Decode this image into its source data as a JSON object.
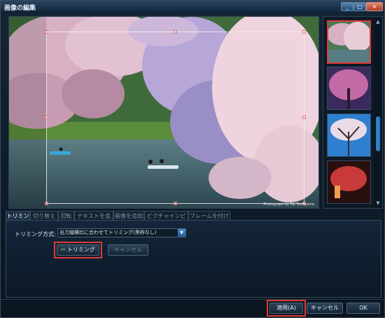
{
  "window": {
    "title": "画像の編集",
    "controls": {
      "minimize": "_",
      "maximize": "□",
      "close": "×"
    }
  },
  "preview": {
    "credit": "Photograph by Eiji Tomiyama"
  },
  "tabs": [
    {
      "label": "トリミング",
      "active": true
    },
    {
      "label": "切り替え",
      "active": false
    },
    {
      "label": "回転",
      "active": false
    },
    {
      "label": "テキストを追加",
      "active": false
    },
    {
      "label": "画像を追加",
      "active": false
    },
    {
      "label": "ピクチャインピクチャ",
      "active": false
    },
    {
      "label": "フレームを付ける",
      "active": false
    }
  ],
  "trimming": {
    "method_label": "トリミング方式:",
    "method_value": "出力縦横比に合わせてトリミング(黒枠なし)",
    "trim_button": "トリミング",
    "cancel_button": "キャンセル"
  },
  "footer": {
    "apply": "適用(A)",
    "cancel": "キャンセル",
    "ok": "OK"
  },
  "colors": {
    "highlight": "#e03a3a",
    "accent": "#2f7fc9"
  }
}
